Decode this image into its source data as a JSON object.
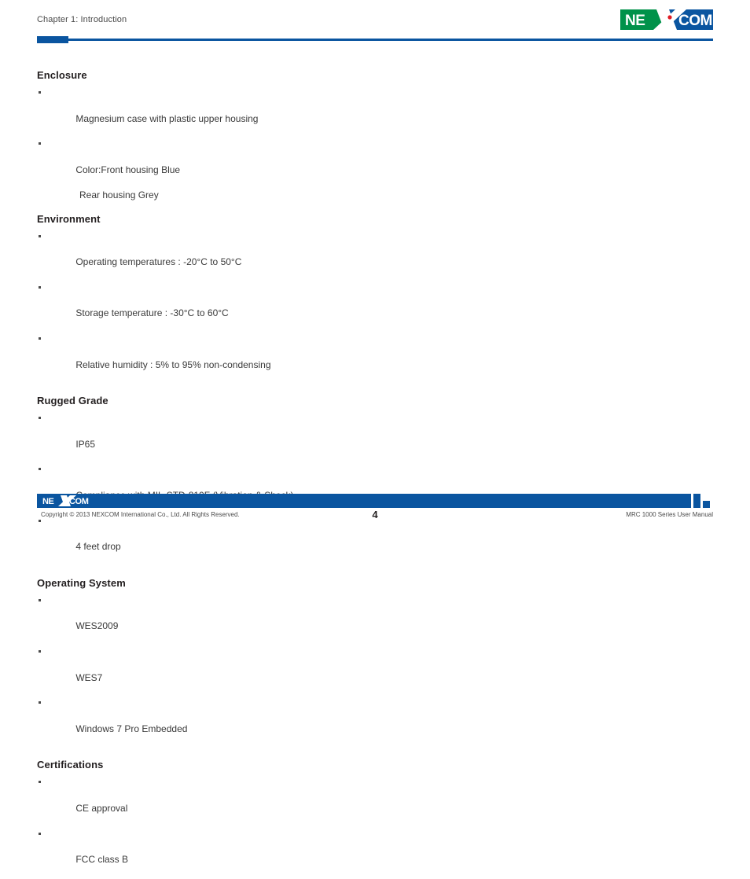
{
  "header": {
    "chapter": "Chapter 1: Introduction",
    "logo": {
      "name": "nexcom-logo",
      "text_left": "NE",
      "text_right": "COM",
      "green": "#00924a",
      "blue": "#0a55a0",
      "accent": "#e01b24"
    }
  },
  "colors": {
    "accent_blue": "#0a55a0",
    "logo_green": "#00924a",
    "body_text": "#3a3a3a",
    "heading_text": "#231f20"
  },
  "main": {
    "sections": [
      {
        "heading": "Enclosure",
        "items": [
          "Magnesium case with plastic upper housing",
          "Color:Front housing Blue"
        ],
        "subline": "Rear housing Grey"
      },
      {
        "heading": "Environment",
        "items": [
          "Operating temperatures : -20°C to 50°C",
          "Storage temperature : -30°C to 60°C",
          "Relative humidity : 5% to 95% non-condensing"
        ]
      },
      {
        "heading": "Rugged Grade",
        "items": [
          "IP65",
          "Compliance with MIL-STD-810F (Vibration & Shock)",
          "4 feet drop"
        ]
      },
      {
        "heading": "Operating System",
        "items": [
          "WES2009",
          "WES7",
          "Windows 7 Pro Embedded"
        ]
      },
      {
        "heading": "Certifications",
        "items": [
          "CE approval",
          "FCC class B"
        ]
      }
    ]
  },
  "footer": {
    "logo_text_left": "NE",
    "logo_text_right": "COM",
    "copyright": "Copyright © 2013 NEXCOM International Co., Ltd. All Rights Reserved.",
    "page_number": "4",
    "manual_title": "MRC 1000 Series User Manual"
  }
}
